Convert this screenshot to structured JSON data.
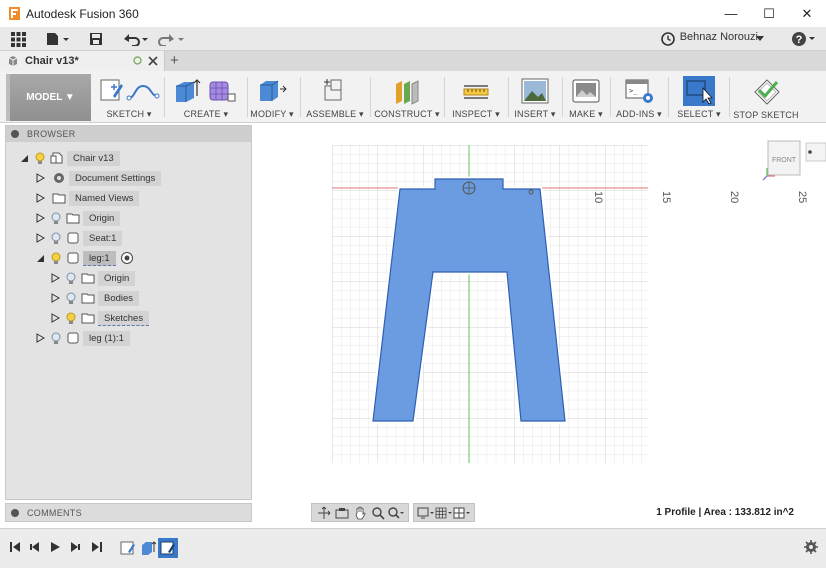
{
  "window": {
    "title": "Autodesk Fusion 360",
    "minimize": "—",
    "maximize": "☐",
    "close": "✕"
  },
  "appbar": {
    "user": "Behnaz Norouzi"
  },
  "tab": {
    "name": "Chair v13*"
  },
  "toolbar": {
    "workspace": "MODEL ▼",
    "groups": [
      {
        "label": "SKETCH ▾"
      },
      {
        "label": "CREATE ▾"
      },
      {
        "label": "MODIFY ▾"
      },
      {
        "label": "ASSEMBLE ▾"
      },
      {
        "label": "CONSTRUCT ▾"
      },
      {
        "label": "INSPECT ▾"
      },
      {
        "label": "INSERT ▾"
      },
      {
        "label": "MAKE ▾"
      },
      {
        "label": "ADD-INS ▾"
      },
      {
        "label": "SELECT ▾"
      },
      {
        "label": "STOP SKETCH"
      }
    ]
  },
  "browser": {
    "header": "BROWSER",
    "items": [
      {
        "label": "Chair v13"
      },
      {
        "label": "Document Settings"
      },
      {
        "label": "Named Views"
      },
      {
        "label": "Origin"
      },
      {
        "label": "Seat:1"
      },
      {
        "label": "leg:1"
      },
      {
        "label": "Origin"
      },
      {
        "label": "Bodies"
      },
      {
        "label": "Sketches"
      },
      {
        "label": "leg (1):1"
      }
    ]
  },
  "comments": {
    "header": "COMMENTS"
  },
  "viewport": {
    "viewcube_face": "FRONT",
    "axis_labels": [
      "10",
      "15",
      "20",
      "25"
    ],
    "status": "1 Profile | Area : 133.812 in^2",
    "sketch_color": "#6b9be0",
    "sketch_outline": "#2f5fb3"
  }
}
